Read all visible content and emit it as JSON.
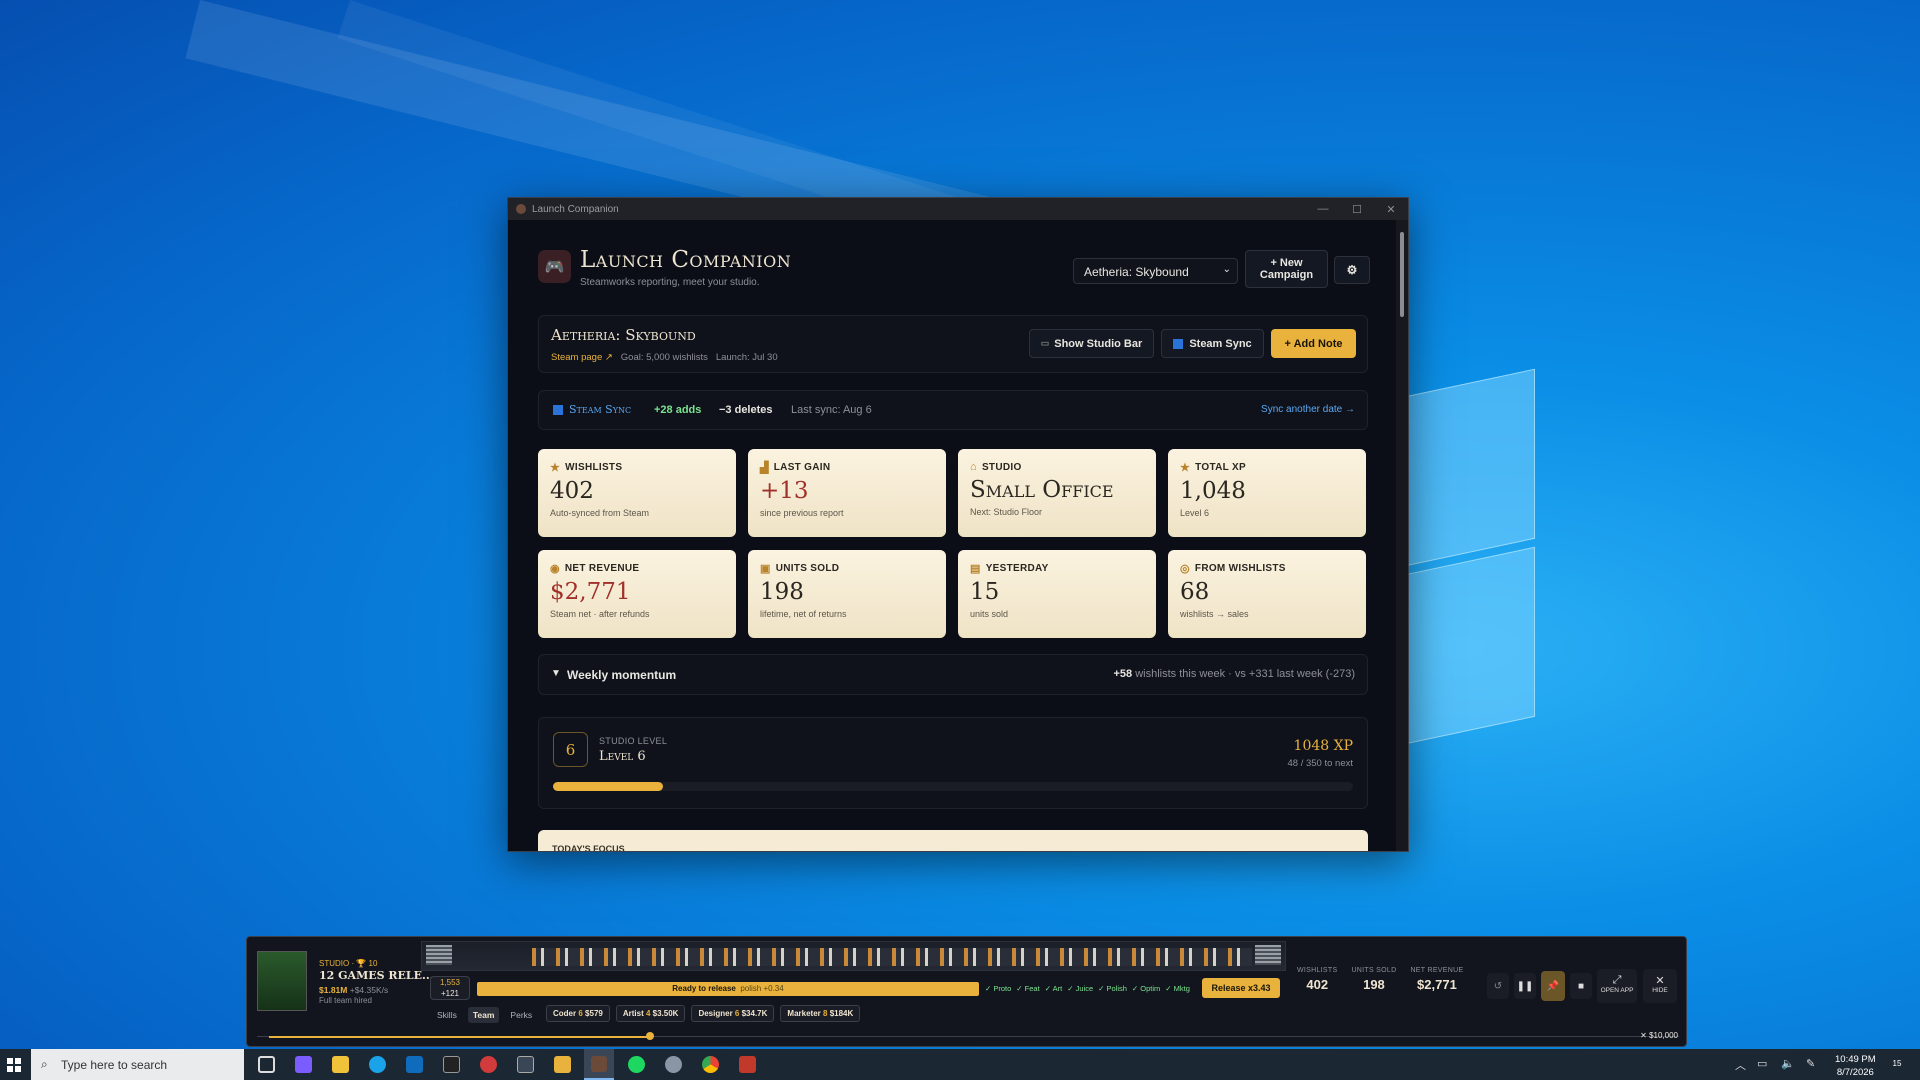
{
  "window": {
    "title": "Launch Companion"
  },
  "app": {
    "title": "Launch Companion",
    "subtitle": "Steamworks reporting, meet your studio.",
    "campaign_select": "Aetheria: Skybound",
    "new_campaign": "+ New Campaign",
    "settings_icon": "gear-icon"
  },
  "campaign": {
    "name": "Aetheria: Skybound",
    "steam_link": "Steam page ↗",
    "goal": "Goal: 5,000 wishlists",
    "launch": "Launch: Jul 30",
    "show_studio_bar": "Show Studio Bar",
    "steam_sync": "Steam Sync",
    "add_note": "+ Add Note"
  },
  "sync": {
    "label": "Steam Sync",
    "adds": "+28 adds",
    "deletes": "−3 deletes",
    "last": "Last sync: Aug 6",
    "another": "Sync another date →"
  },
  "stats": [
    {
      "label": "WISHLISTS",
      "icon": "star-icon",
      "value": "402",
      "sub": "Auto-synced from Steam"
    },
    {
      "label": "LAST GAIN",
      "icon": "chart-icon",
      "value": "+13",
      "sub": "since previous report"
    },
    {
      "label": "STUDIO",
      "icon": "building-icon",
      "value": "Small Office",
      "sub": "Next: Studio Floor"
    },
    {
      "label": "TOTAL XP",
      "icon": "star-icon",
      "value": "1,048",
      "sub": "Level 6"
    },
    {
      "label": "NET REVENUE",
      "icon": "moneybag-icon",
      "value": "$2,771",
      "sub": "Steam net · after refunds"
    },
    {
      "label": "UNITS SOLD",
      "icon": "box-icon",
      "value": "198",
      "sub": "lifetime, net of returns"
    },
    {
      "label": "YESTERDAY",
      "icon": "calendar-icon",
      "value": "15",
      "sub": "units sold"
    },
    {
      "label": "FROM WISHLISTS",
      "icon": "target-icon",
      "value": "68",
      "sub": "wishlists → sales"
    }
  ],
  "momentum": {
    "label": "Weekly momentum",
    "count": "+58",
    "rest": "wishlists this week · vs +331 last week (-273)"
  },
  "level": {
    "number": "6",
    "caption": "STUDIO LEVEL",
    "name": "Level 6",
    "xp": "1048 XP",
    "next": "48 / 350 to next",
    "progress": 0.137
  },
  "focus": {
    "label": "TODAY'S FOCUS"
  },
  "studio_bar": {
    "studio_label": "STUDIO · 🏆 10",
    "headline": "12 GAMES RELE...",
    "money": "$1.81M",
    "rate": "+$4.35K/s",
    "hired": "Full team hired",
    "score_top": "1,553",
    "score_bottom": "+121",
    "progress_text": "Ready to release",
    "polish": "polish +0.34",
    "stages": [
      "✓ Proto",
      "✓ Feat",
      "✓ Art",
      "✓ Juice",
      "✓ Polish",
      "✓ Optim",
      "✓ Mktg"
    ],
    "release": "Release x3.43",
    "tabs": [
      "Skills",
      "Team",
      "Perks"
    ],
    "roles": [
      {
        "role": "Coder",
        "level": "6",
        "cost": "$579"
      },
      {
        "role": "Artist",
        "level": "4",
        "cost": "$3.50K"
      },
      {
        "role": "Designer",
        "level": "6",
        "cost": "$34.7K"
      },
      {
        "role": "Marketer",
        "level": "8",
        "cost": "$184K"
      }
    ],
    "metrics": [
      {
        "label": "WISHLISTS",
        "value": "402"
      },
      {
        "label": "UNITS SOLD",
        "value": "198"
      },
      {
        "label": "NET REVENUE",
        "value": "$2,771"
      }
    ],
    "open_app": "OPEN APP",
    "hide": "HIDE",
    "goal": "✕ $10,000"
  },
  "taskbar": {
    "search": "Type here to search",
    "time": "10:49 PM",
    "date": "8/7/2026",
    "notif": "15"
  }
}
